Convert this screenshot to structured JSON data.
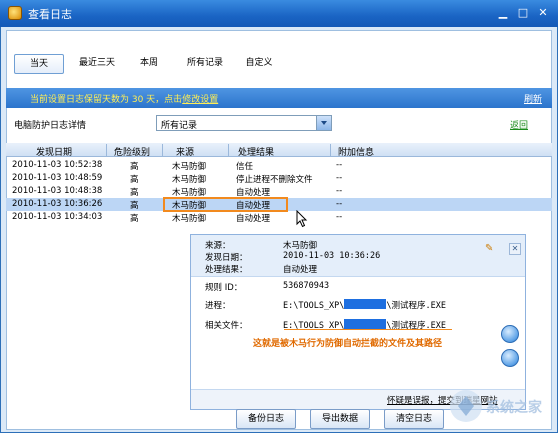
{
  "window": {
    "title": "查看日志"
  },
  "tabs": [
    {
      "label": "当天"
    },
    {
      "label": "最近三天"
    },
    {
      "label": "本周"
    },
    {
      "label": "所有记录"
    },
    {
      "label": "自定义"
    }
  ],
  "info": {
    "text": "当前设置日志保留天数为 30 天，点击",
    "link": "修改设置",
    "refresh": "刷新"
  },
  "filter": {
    "label": "电脑防护日志详情",
    "selected": "所有记录",
    "back": "返回"
  },
  "table": {
    "headers": [
      "发现日期",
      "危险级别",
      "来源",
      "处理结果",
      "附加信息"
    ],
    "rows": [
      {
        "date": "2010-11-03 10:52:38",
        "level": "高",
        "source": "木马防御",
        "result": "信任",
        "extra": "--"
      },
      {
        "date": "2010-11-03 10:48:59",
        "level": "高",
        "source": "木马防御",
        "result": "停止进程不删除文件",
        "extra": "--"
      },
      {
        "date": "2010-11-03 10:48:38",
        "level": "高",
        "source": "木马防御",
        "result": "自动处理",
        "extra": "--"
      },
      {
        "date": "2010-11-03 10:36:26",
        "level": "高",
        "source": "木马防御",
        "result": "自动处理",
        "extra": "--"
      },
      {
        "date": "2010-11-03 10:34:03",
        "level": "高",
        "source": "木马防御",
        "result": "自动处理",
        "extra": "--"
      }
    ]
  },
  "popup": {
    "source_label": "来源：",
    "source_value": "木马防御",
    "date_label": "发现日期：",
    "date_value": "2010-11-03 10:36:26",
    "result_label": "处理结果：",
    "result_value": "自动处理",
    "rule_label": "规则 ID：",
    "rule_value": "536870943",
    "process_label": "进程：",
    "process_prefix": "E:\\TOOLS_XP\\",
    "process_suffix": "\\测试程序.EXE",
    "file_label": "相关文件：",
    "file_prefix": "E:\\TOOLS_XP\\",
    "file_suffix": "\\测试程序.EXE",
    "note": "这就是被木马行为防御自动拦截的文件及其路径",
    "footer_text": "怀疑是误报，提交到瑞星网站"
  },
  "buttons": {
    "backup": "备份日志",
    "export": "导出数据",
    "clear": "清空日志"
  },
  "watermark": "系统之家",
  "colors": {
    "accent": "#1a64c4",
    "highlight": "#f28a1e",
    "note": "#e06a00"
  }
}
